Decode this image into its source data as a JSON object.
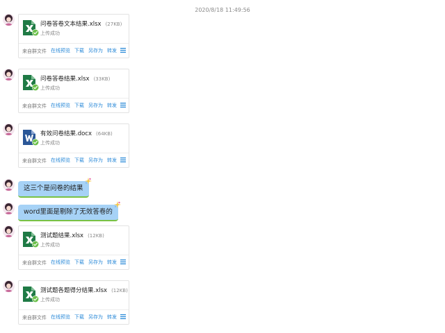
{
  "timestamp": "2020/8/18 11:49:56",
  "messages": [
    {
      "kind": "file",
      "file_type": "xlsx",
      "icon": "excel-file-icon",
      "name": "问卷答卷文本结果.xlsx",
      "size": "(27KB)",
      "status": "上传成功",
      "source": "来自群文件",
      "actions": [
        "在线预览",
        "下载",
        "另存为",
        "转发"
      ]
    },
    {
      "kind": "file",
      "file_type": "xlsx",
      "icon": "excel-file-icon",
      "name": "问卷答卷结果.xlsx",
      "size": "(33KB)",
      "status": "上传成功",
      "source": "来自群文件",
      "actions": [
        "在线预览",
        "下载",
        "另存为",
        "转发"
      ]
    },
    {
      "kind": "file",
      "file_type": "docx",
      "icon": "word-file-icon",
      "name": "有效问卷结果.docx",
      "size": "(64KB)",
      "status": "上传成功",
      "source": "来自群文件",
      "actions": [
        "在线预览",
        "下载",
        "另存为",
        "转发"
      ]
    },
    {
      "kind": "text",
      "text": "这三个是问卷的结果"
    },
    {
      "kind": "text",
      "text": "word里面是剔除了无效答卷的"
    },
    {
      "kind": "file",
      "file_type": "xlsx",
      "icon": "excel-file-icon",
      "name": "测试题结果.xlsx",
      "size": "(12KB)",
      "status": "上传成功",
      "source": "来自群文件",
      "actions": [
        "在线预览",
        "下载",
        "另存为",
        "转发"
      ]
    },
    {
      "kind": "file",
      "file_type": "xlsx",
      "icon": "excel-file-icon",
      "name": "测试题各题得分结果.xlsx",
      "size": "(12KB)",
      "status": "上传成功",
      "source": "来自群文件",
      "actions": [
        "在线预览",
        "下载",
        "另存为",
        "转发"
      ]
    }
  ],
  "colors": {
    "excel": "#1f7a45",
    "word": "#2b5797",
    "link": "#2b8ad8",
    "bubble": "#a6d2f6",
    "bubble_border": "#79c243",
    "check": "#6cc04a"
  }
}
